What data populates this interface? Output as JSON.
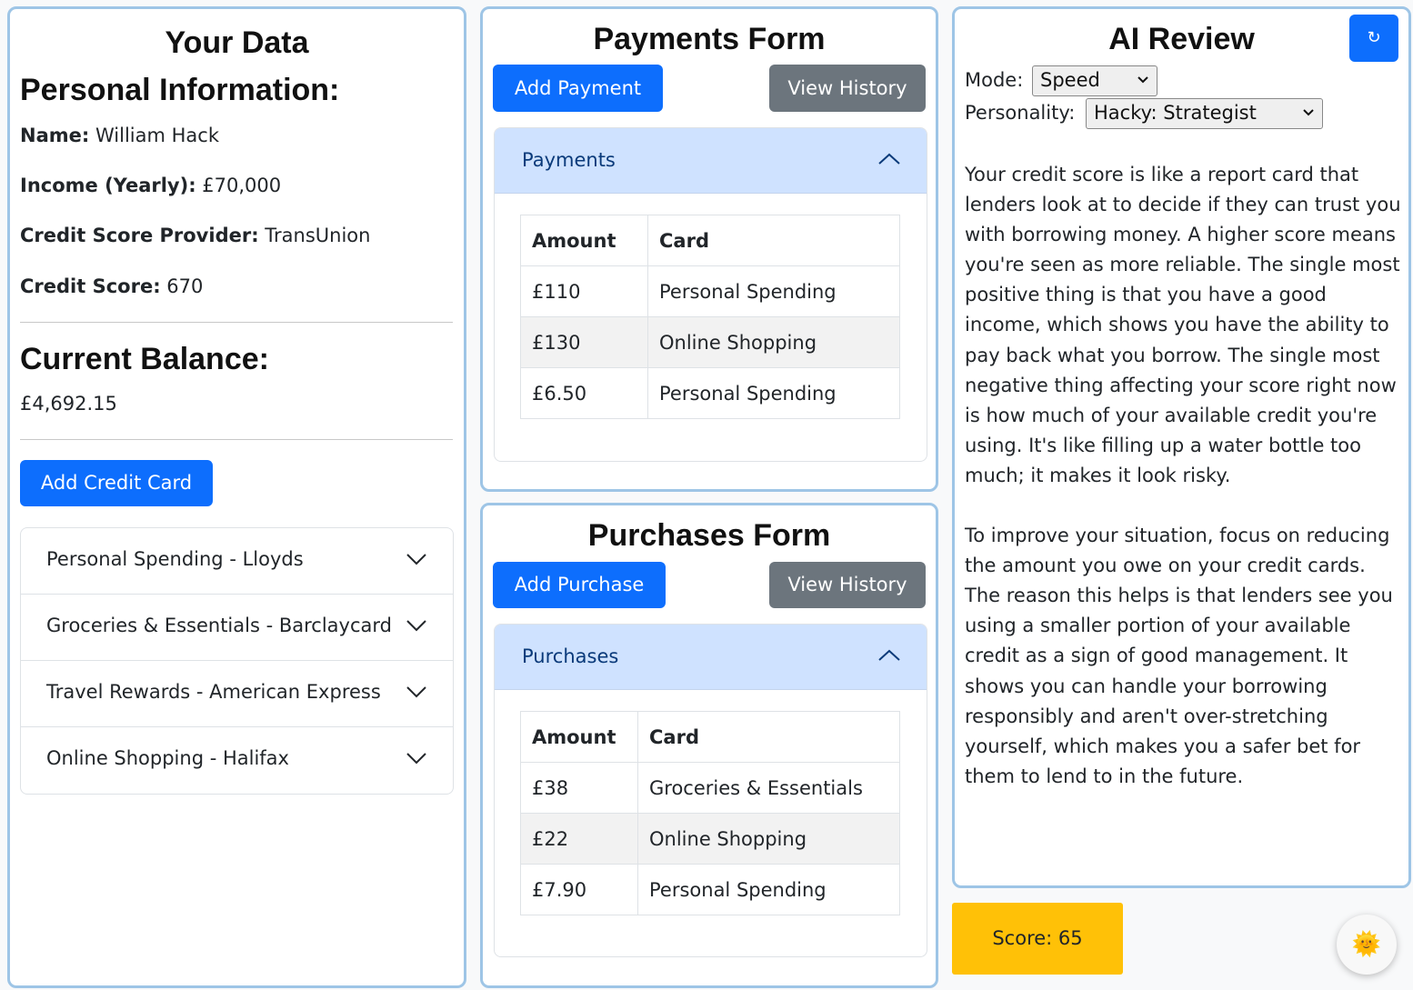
{
  "your_data": {
    "title": "Your Data",
    "personal_heading": "Personal Information:",
    "name_label": "Name:",
    "name_value": "William Hack",
    "income_label": "Income (Yearly):",
    "income_value": "£70,000",
    "provider_label": "Credit Score Provider:",
    "provider_value": "TransUnion",
    "score_label": "Credit Score:",
    "score_value": "670",
    "balance_heading": "Current Balance:",
    "balance_value": "£4,692.15",
    "add_card_label": "Add Credit Card",
    "cards": [
      "Personal Spending - Lloyds",
      "Groceries & Essentials - Barclaycard",
      "Travel Rewards - American Express",
      "Online Shopping - Halifax"
    ]
  },
  "payments": {
    "title": "Payments Form",
    "add_label": "Add Payment",
    "history_label": "View History",
    "section_label": "Payments",
    "columns": [
      "Amount",
      "Card"
    ],
    "rows": [
      [
        "£110",
        "Personal Spending"
      ],
      [
        "£130",
        "Online Shopping"
      ],
      [
        "£6.50",
        "Personal Spending"
      ]
    ]
  },
  "purchases": {
    "title": "Purchases Form",
    "add_label": "Add Purchase",
    "history_label": "View History",
    "section_label": "Purchases",
    "columns": [
      "Amount",
      "Card"
    ],
    "rows": [
      [
        "£38",
        "Groceries & Essentials"
      ],
      [
        "£22",
        "Online Shopping"
      ],
      [
        "£7.90",
        "Personal Spending"
      ]
    ]
  },
  "ai_review": {
    "title": "AI Review",
    "refresh_icon": "↻",
    "mode_label": "Mode:",
    "mode_value": "Speed",
    "personality_label": "Personality:",
    "personality_value": "Hacky: Strategist",
    "paragraphs": [
      "Your credit score is like a report card that lenders look at to decide if they can trust you with borrowing money. A higher score means you're seen as more reliable. The single most positive thing is that you have a good income, which shows you have the ability to pay back what you borrow. The single most negative thing affecting your score right now is how much of your available credit you're using. It's like filling up a water bottle too much; it makes it look risky.",
      "To improve your situation, focus on reducing the amount you owe on your credit cards. The reason this helps is that lenders see you using a smaller portion of your available credit as a sign of good management. It shows you can handle your borrowing responsibly and aren't over-stretching yourself, which makes you a safer bet for them to lend to in the future."
    ],
    "score_label": "Score: 65"
  },
  "assistant": {
    "icon": "🌞"
  },
  "colors": {
    "primary": "#0d6efd",
    "secondary": "#6c757d",
    "panel_border": "#9ec5e6",
    "accordion_header": "#cfe2ff",
    "score_badge": "#ffc107"
  }
}
